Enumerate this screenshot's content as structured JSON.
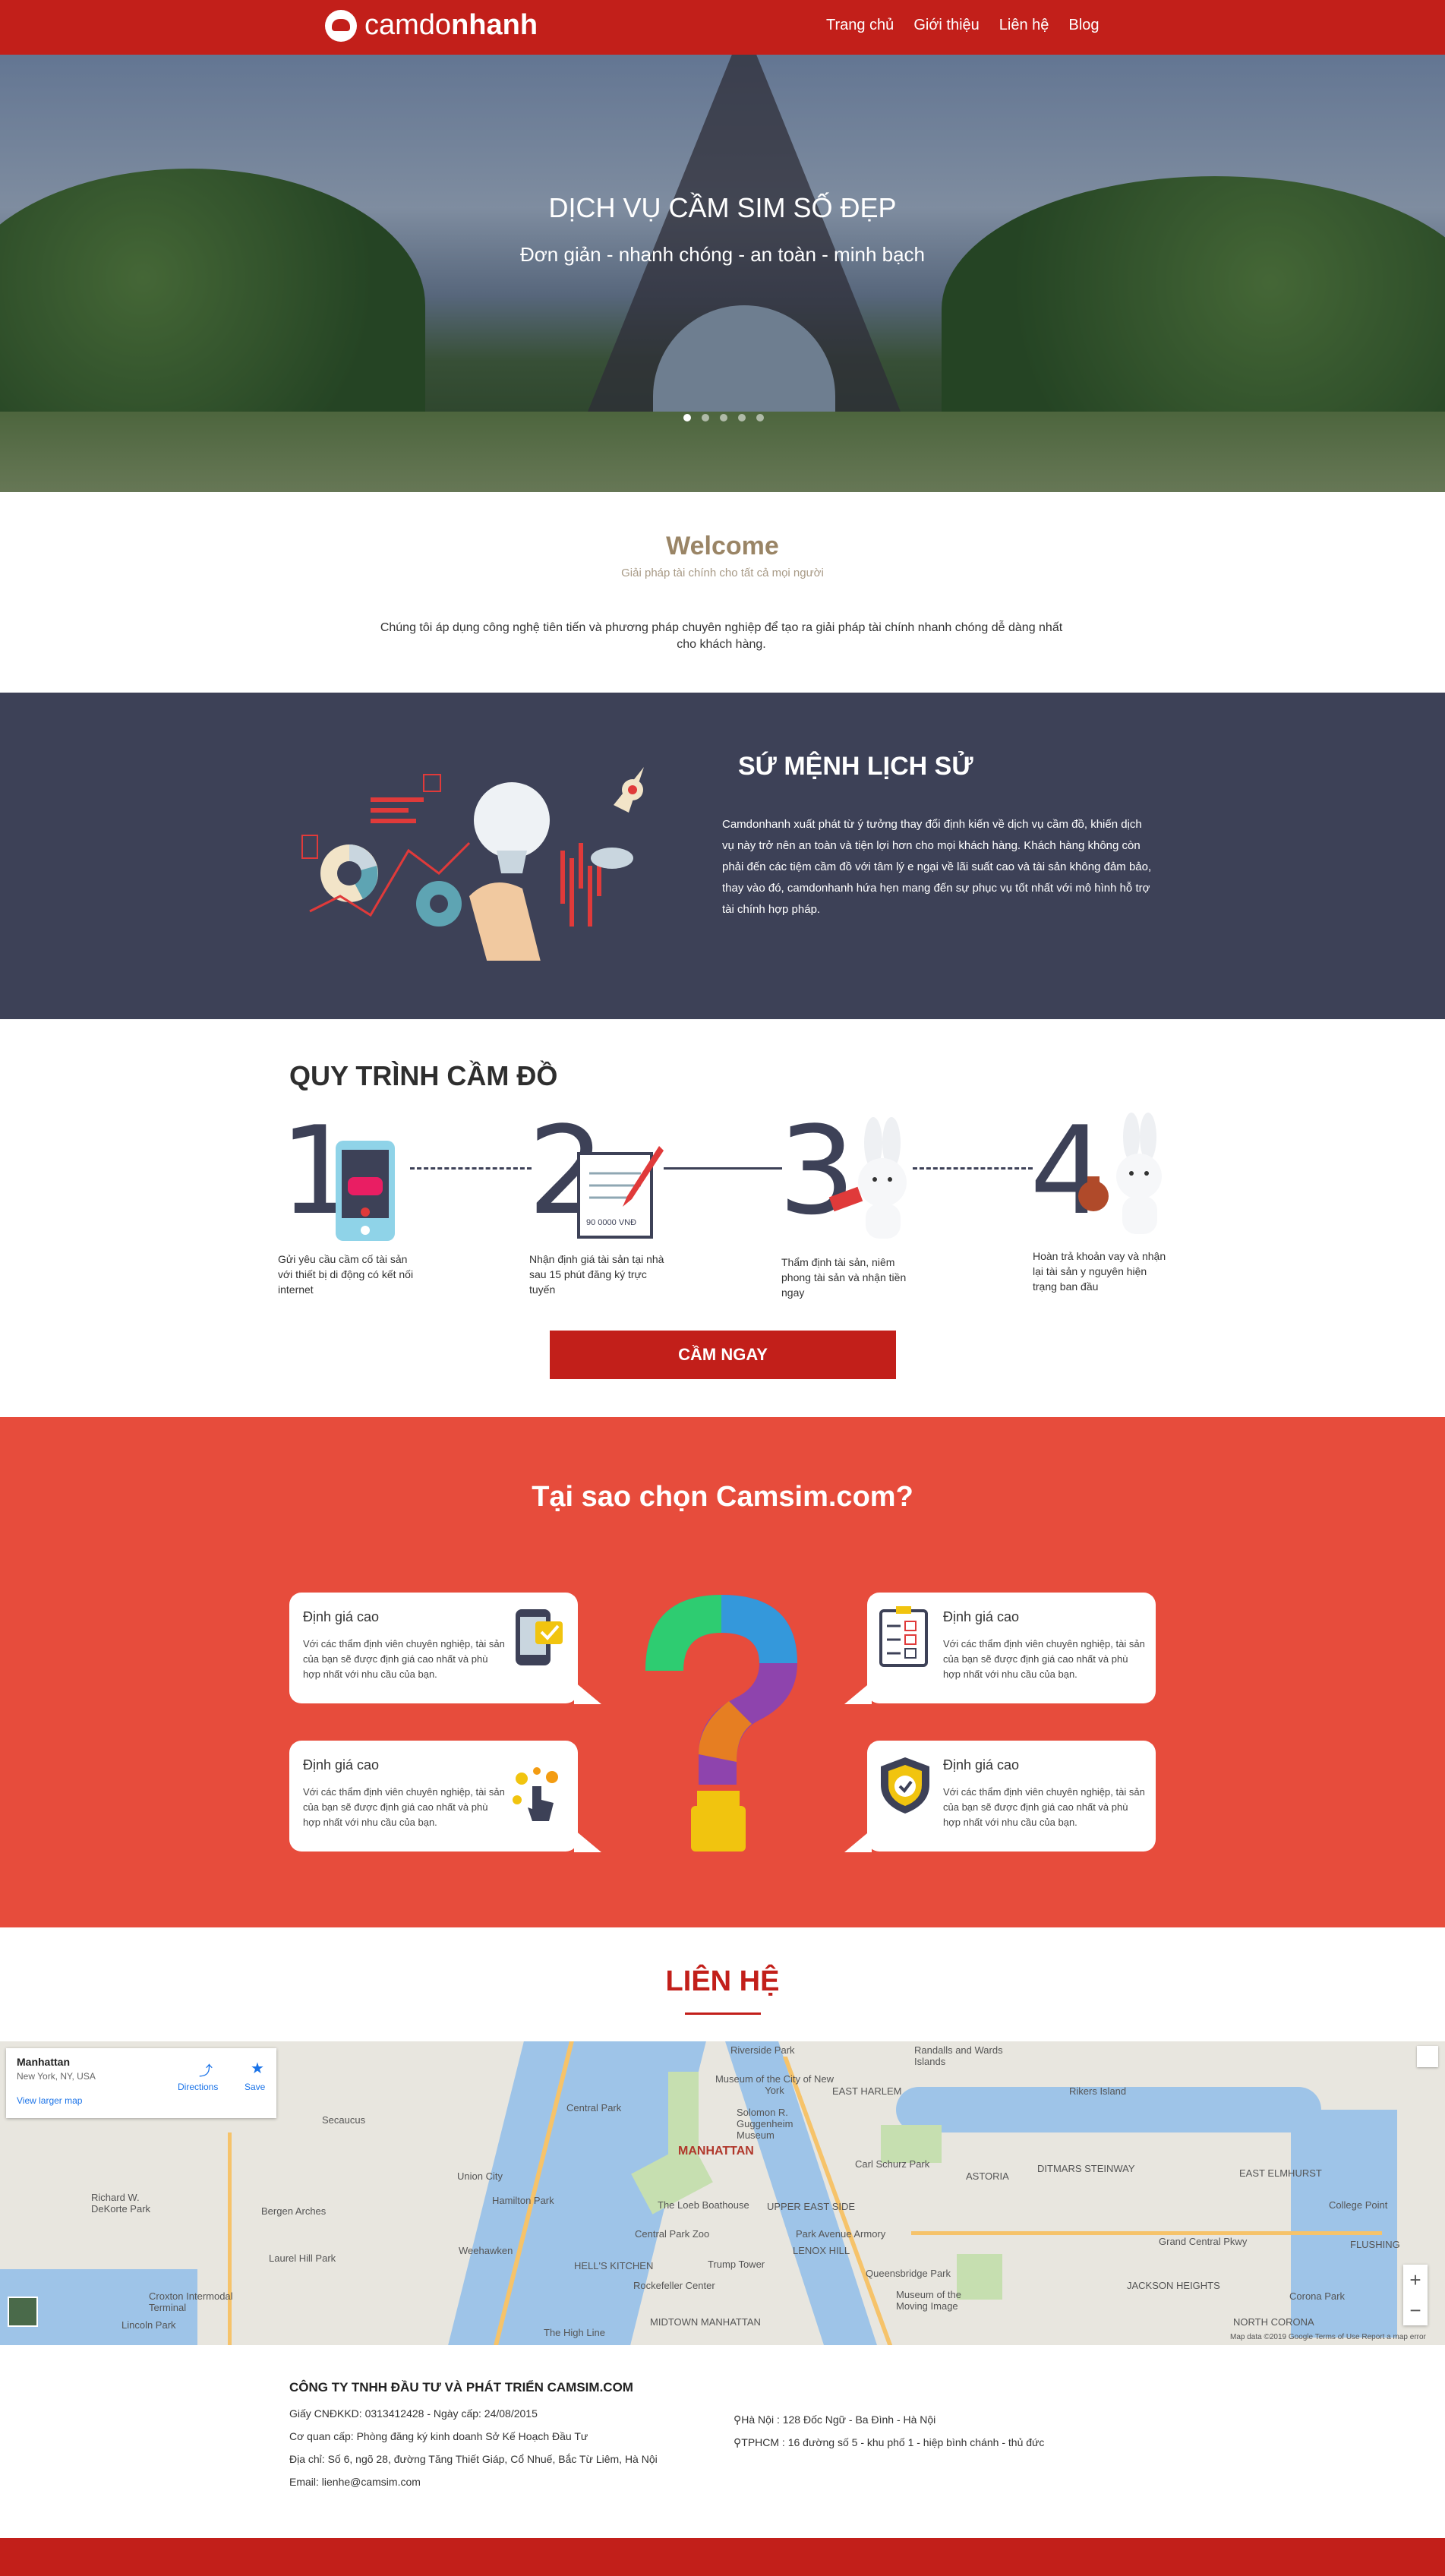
{
  "header": {
    "logo_light": "camdo",
    "logo_bold": "nhanh",
    "nav": [
      "Trang chủ",
      "Giới thiệu",
      "Liên hệ",
      "Blog"
    ]
  },
  "hero": {
    "title": "DỊCH VỤ CẦM SIM SỐ ĐẸP",
    "subtitle": "Đơn giản - nhanh chóng - an toàn - minh bạch",
    "slides": 5,
    "active_slide": 1
  },
  "welcome": {
    "title": "Welcome",
    "subtitle": "Giải pháp tài chính cho tất cả mọi người",
    "text": "Chúng tôi áp dụng công nghệ tiên tiến và phương pháp chuyên nghiệp để tạo ra giải pháp tài chính nhanh chóng dễ dàng nhất cho khách hàng."
  },
  "mission": {
    "title": "SỨ MỆNH LỊCH SỬ",
    "text": "Camdonhanh xuất phát từ ý tưởng thay đổi định kiến về dịch vụ cầm đồ, khiến dịch vụ này trở nên an toàn và tiện lợi hơn cho mọi khách hàng. Khách hàng không còn phải đến các tiệm cầm đồ với tâm lý e ngại về lãi suất cao và tài sản không đảm bảo, thay vào đó, camdonhanh hứa hẹn mang đến sự phục vụ tốt nhất với mô hình hỗ trợ tài chính hợp pháp."
  },
  "process": {
    "title": "QUY TRÌNH CẦM ĐỒ",
    "steps": [
      {
        "num": "1",
        "text": "Gửi yêu cầu cầm cố tài sản với thiết bị di động có kết nối internet"
      },
      {
        "num": "2",
        "text": "Nhận định giá tài sản tại nhà sau 15 phút đăng ký trực tuyến"
      },
      {
        "num": "3",
        "text": "Thẩm định tài sản, niêm phong tài sản và nhận tiền ngay"
      },
      {
        "num": "4",
        "text": "Hoàn trả khoản vay và nhận lại tài sản y nguyên hiện trạng ban đầu"
      }
    ],
    "paper_amount": "90 0000 VNĐ",
    "cta": "CẦM NGAY"
  },
  "why": {
    "title": "Tại sao chọn Camsim.com?",
    "cards": [
      {
        "title": "Định giá cao",
        "text": "Với các thẩm định viên chuyên nghiệp, tài sản của bạn sẽ được định giá cao nhất và phù hợp nhất với nhu cầu của bạn."
      },
      {
        "title": "Định giá cao",
        "text": "Với các thẩm định viên chuyên nghiệp, tài sản của bạn sẽ được định giá cao nhất và phù hợp nhất với nhu cầu của bạn."
      },
      {
        "title": "Định giá cao",
        "text": "Với các thẩm định viên chuyên nghiệp, tài sản của bạn sẽ được định giá cao nhất và phù hợp nhất với nhu cầu của bạn."
      },
      {
        "title": "Định giá cao",
        "text": "Với các thẩm định viên chuyên nghiệp, tài sản của bạn sẽ được định giá cao nhất và phù hợp nhất với nhu cầu của bạn."
      }
    ]
  },
  "contact": {
    "title": "LIÊN HỆ",
    "map": {
      "place": "Manhattan",
      "place_sub": "New York, NY, USA",
      "larger_map": "View larger map",
      "directions": "Directions",
      "save": "Save",
      "labels": [
        "MANHATTAN",
        "Riverside Park",
        "Museum of the City of New York",
        "EAST HARLEM",
        "Randalls and Wards Islands",
        "Rikers Island",
        "Secaucus",
        "Union City",
        "Hamilton Park",
        "Weehawken",
        "Central Park Zoo",
        "The Loeb Boathouse",
        "UPPER EAST SIDE",
        "ASTORIA",
        "DITMARS STEINWAY",
        "EAST ELMHURST",
        "FLUSHING",
        "HELL'S KITCHEN",
        "Rockefeller Center",
        "Trump Tower",
        "MIDTOWN MANHATTAN",
        "The High Line",
        "JACKSON HEIGHTS",
        "NORTH CORONA",
        "Grand Central Pkwy",
        "Solomon R. Guggenheim Museum",
        "Carl Schurz Park",
        "Park Avenue Armory",
        "LENOX HILL",
        "Queensbridge Park",
        "Museum of the Moving Image",
        "Richard W. DeKorte Park",
        "Bergen Arches",
        "Croxton Intermodal Terminal",
        "Lincoln Park",
        "Laurel Hill Park",
        "College Point",
        "Corona Park",
        "Central Park"
      ],
      "attribution": "Map data ©2019 Google   Terms of Use   Report a map error"
    }
  },
  "footer": {
    "company": "CÔNG TY TNHH ĐẦU TƯ VÀ PHÁT TRIỂN CAMSIM.COM",
    "lines": [
      "Giấy CNĐKKD: 0313412428 - Ngày cấp: 24/08/2015",
      "Cơ quan cấp: Phòng đăng ký kinh doanh Sở Kế Hoạch Đầu Tư",
      "Địa chỉ: Số 6, ngõ 28, đường Tăng Thiết Giáp, Cổ Nhuế, Bắc Từ Liêm, Hà Nội",
      "Email: lienhe@camsim.com"
    ],
    "addresses": [
      "Hà Nội : 128 Đốc Ngữ - Ba Đình - Hà Nội",
      "TPHCM : 16 đường số 5 - khu phố 1 - hiệp bình chánh - thủ đức"
    ]
  }
}
